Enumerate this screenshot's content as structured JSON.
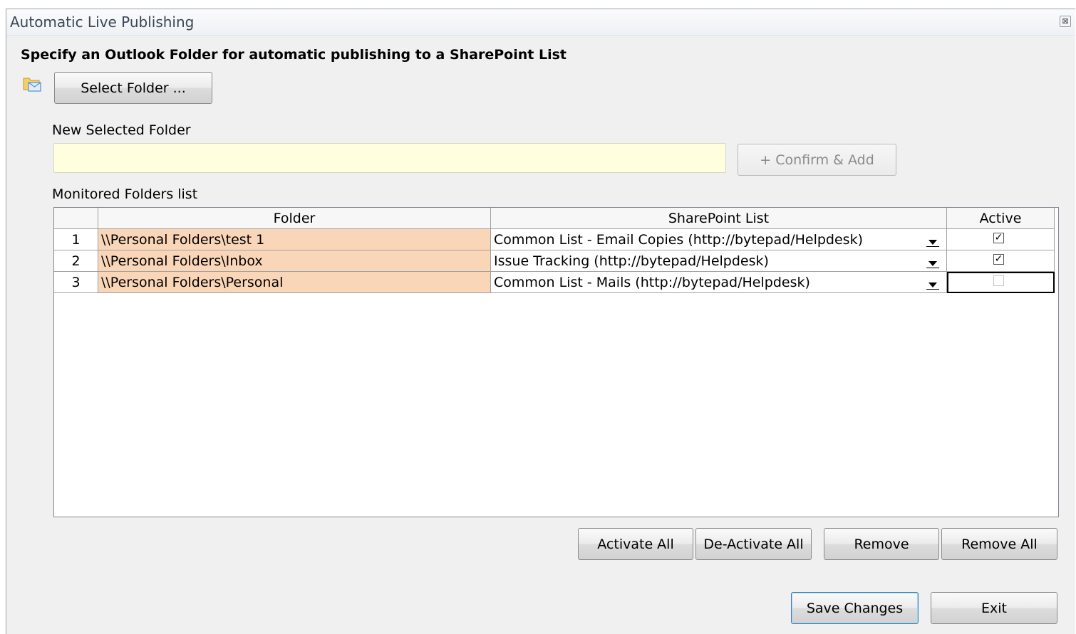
{
  "window": {
    "title": "Automatic Live Publishing",
    "close_glyph": "⊠"
  },
  "heading": "Specify an Outlook Folder for automatic publishing to a SharePoint List",
  "select_folder": {
    "label": "Select Folder ...",
    "icon": "outlook-folder-icon"
  },
  "new_folder": {
    "label": "New Selected Folder",
    "value": "",
    "confirm_label": "+ Confirm & Add"
  },
  "monitored": {
    "label": "Monitored Folders list",
    "columns": [
      "",
      "Folder",
      "SharePoint List",
      "Active"
    ],
    "rows": [
      {
        "num": "1",
        "folder": "\\\\Personal Folders\\test 1",
        "sharepoint": "Common List - Email Copies (http://bytepad/Helpdesk)",
        "active": true
      },
      {
        "num": "2",
        "folder": "\\\\Personal Folders\\Inbox",
        "sharepoint": "Issue Tracking (http://bytepad/Helpdesk)",
        "active": true
      },
      {
        "num": "3",
        "folder": "\\\\Personal Folders\\Personal",
        "sharepoint": "Common List - Mails (http://bytepad/Helpdesk)",
        "active": false
      }
    ]
  },
  "actions": {
    "activate_all": "Activate All",
    "deactivate_all": "De-Activate All",
    "remove": "Remove",
    "remove_all": "Remove All"
  },
  "footer": {
    "save": "Save Changes",
    "exit": "Exit"
  },
  "colors": {
    "folder_cell_bg": "#fad6b8",
    "input_bg": "#ffffe0",
    "window_bg": "#f0f0f0"
  }
}
